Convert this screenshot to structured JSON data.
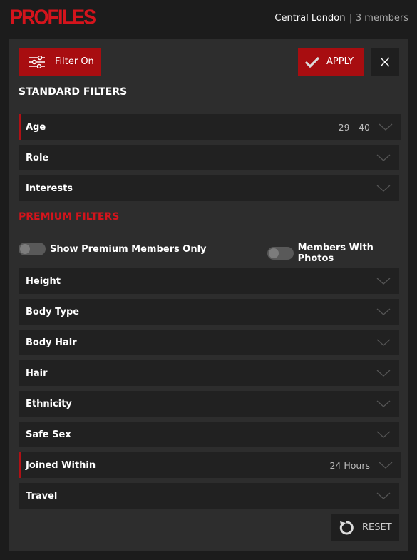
{
  "header": {
    "logo": "PROFILES",
    "location": "Central London",
    "separator": "|",
    "members": "3 members"
  },
  "toolbar": {
    "filter_label": "Filter On",
    "apply_label": "APPLY"
  },
  "standard": {
    "title": "STANDARD FILTERS",
    "items": [
      {
        "label": "Age",
        "value": "29 - 40"
      },
      {
        "label": "Role",
        "value": ""
      },
      {
        "label": "Interests",
        "value": ""
      }
    ]
  },
  "premium": {
    "title": "PREMIUM FILTERS",
    "toggle_premium_label": "Show Premium Members Only",
    "toggle_photos_label": "Members With Photos",
    "items": [
      {
        "label": "Height",
        "value": ""
      },
      {
        "label": "Body Type",
        "value": ""
      },
      {
        "label": "Body Hair",
        "value": ""
      },
      {
        "label": "Hair",
        "value": ""
      },
      {
        "label": "Ethnicity",
        "value": ""
      },
      {
        "label": "Safe Sex",
        "value": ""
      },
      {
        "label": "Joined Within",
        "value": "24 Hours"
      },
      {
        "label": "Travel",
        "value": ""
      }
    ]
  },
  "footer": {
    "reset_label": "RESET"
  },
  "colors": {
    "accent": "#a80d10",
    "logo": "#d4141c",
    "panel": "#2d2d2d",
    "row": "#212121"
  }
}
